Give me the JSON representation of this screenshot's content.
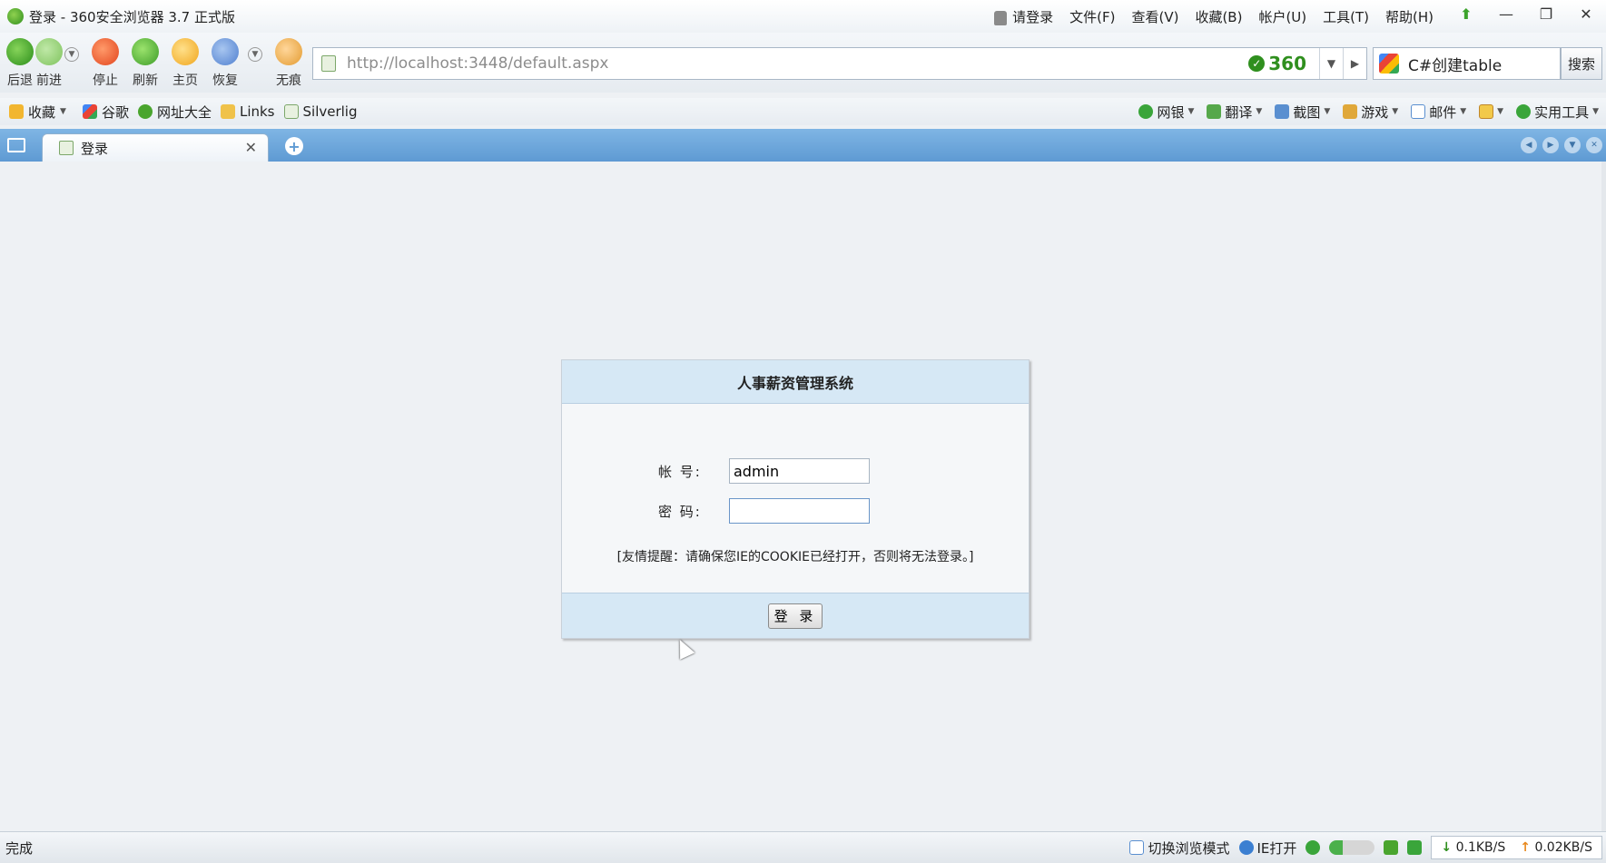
{
  "window": {
    "title": "登录 - 360安全浏览器 3.7 正式版",
    "menu": [
      "请登录",
      "文件(F)",
      "查看(V)",
      "收藏(B)",
      "帐户(U)",
      "工具(T)",
      "帮助(H)"
    ]
  },
  "toolbar": {
    "back": "后退",
    "forward": "前进",
    "stop": "停止",
    "refresh": "刷新",
    "home": "主页",
    "restore": "恢复",
    "incognito": "无痕",
    "url": "http://localhost:3448/default.aspx",
    "badge": "360",
    "search_query": "C#创建table",
    "search_button": "搜索"
  },
  "bookmarks": {
    "left": [
      "收藏",
      "谷歌",
      "网址大全",
      "Links",
      "Silverlig"
    ],
    "right": [
      "网银",
      "翻译",
      "截图",
      "游戏",
      "邮件",
      "",
      "实用工具"
    ]
  },
  "tabs": [
    {
      "label": "登录",
      "active": true
    }
  ],
  "login": {
    "title": "人事薪资管理系统",
    "account_label": "帐  号:",
    "account_value": "admin",
    "password_label": "密  码:",
    "password_value": "",
    "tip": "[友情提醒：请确保您IE的COOKIE已经打开，否则将无法登录。]",
    "submit": "登 录"
  },
  "status": {
    "left": "完成",
    "switch_mode": "切换浏览模式",
    "ie_open": "IE打开",
    "download_speed": "0.1KB/S",
    "upload_speed": "0.02KB/S"
  }
}
